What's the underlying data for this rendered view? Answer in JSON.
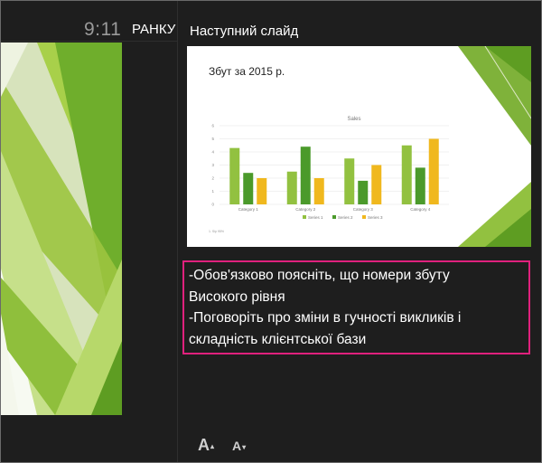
{
  "header": {
    "time": "9:11",
    "ampm": "РАНКУ"
  },
  "next_slide": {
    "label": "Наступний слайд",
    "slide_title": "Збут за 2015 р.",
    "footer_note": "1. Sip 95%"
  },
  "notes": {
    "lines": [
      "-Обов'язково поясніть, що номери збуту",
      "Високого рівня",
      "-Поговоріть про зміни в гучності викликів і",
      "складність клієнтської бази"
    ],
    "highlight_color": "#e0217d"
  },
  "toolbar": {
    "font_up_label": "A",
    "font_down_label": "A",
    "caret": "▾"
  },
  "theme": {
    "slide_green_light": "#a9cf4a",
    "slide_green_dark": "#5f9e22",
    "background": "#1e1e1e"
  },
  "chart_data": {
    "type": "bar",
    "title": "Sales",
    "categories": [
      "Category 1",
      "Category 2",
      "Category 3",
      "Category 4"
    ],
    "series": [
      {
        "name": "Series 1",
        "values": [
          4.3,
          2.5,
          3.5,
          4.5
        ],
        "color": "#92c140"
      },
      {
        "name": "Series 2",
        "values": [
          2.4,
          4.4,
          1.8,
          2.8
        ],
        "color": "#4b9a2b"
      },
      {
        "name": "Series 3",
        "values": [
          2.0,
          2.0,
          3.0,
          5.0
        ],
        "color": "#f0b81e"
      }
    ],
    "yticks": [
      "0",
      "1",
      "2",
      "3",
      "4",
      "5",
      "6"
    ],
    "ylim": [
      0,
      6
    ],
    "grid": true,
    "legend": "bottom"
  }
}
